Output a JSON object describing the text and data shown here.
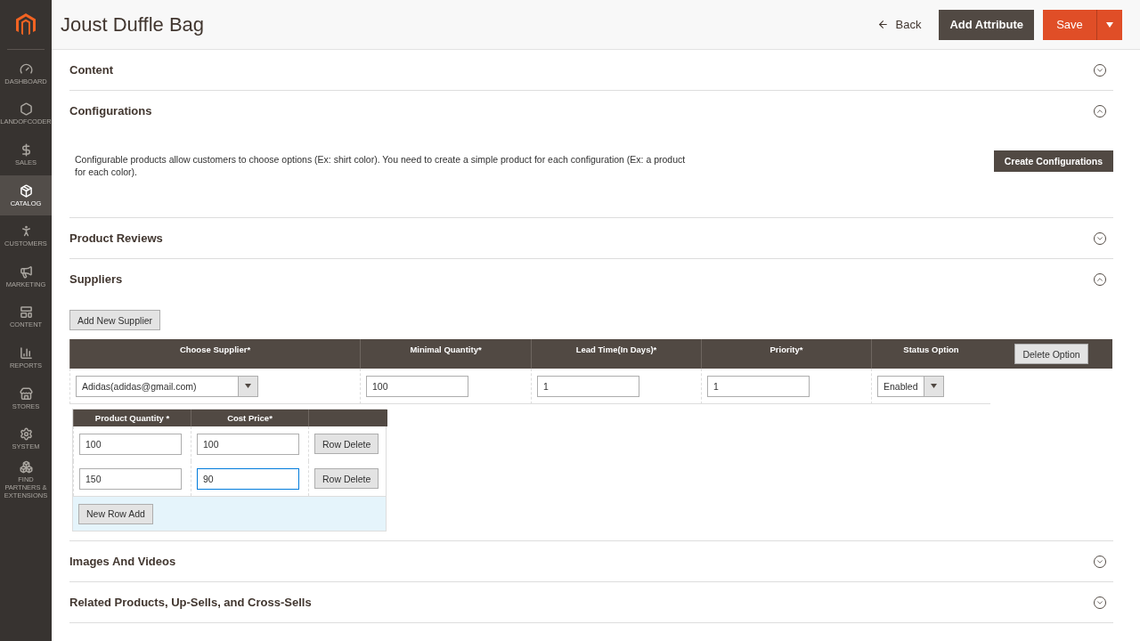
{
  "sidebar": {
    "items": [
      {
        "label": "DASHBOARD",
        "selected": false
      },
      {
        "label": "LANDOFCODER",
        "selected": false
      },
      {
        "label": "SALES",
        "selected": false
      },
      {
        "label": "CATALOG",
        "selected": true
      },
      {
        "label": "CUSTOMERS",
        "selected": false
      },
      {
        "label": "MARKETING",
        "selected": false
      },
      {
        "label": "CONTENT",
        "selected": false
      },
      {
        "label": "REPORTS",
        "selected": false
      },
      {
        "label": "STORES",
        "selected": false
      },
      {
        "label": "SYSTEM",
        "selected": false
      },
      {
        "label": "FIND PARTNERS & EXTENSIONS",
        "selected": false
      }
    ]
  },
  "header": {
    "title": "Joust Duffle Bag",
    "back": "Back",
    "add_attribute": "Add Attribute",
    "save": "Save"
  },
  "sections": [
    {
      "title": "Content",
      "expanded": false
    },
    {
      "kind": "text",
      "title": "Configurations",
      "expanded": true,
      "description": "Configurable products allow customers to choose options (Ex: shirt color). You need to create a simple product for each configuration (Ex: a product for each color).",
      "button": "Create Configurations"
    },
    {
      "title": "Product Reviews",
      "expanded": false
    },
    {
      "kind": "suppliers",
      "title": "Suppliers",
      "expanded": true,
      "add_button": "Add New Supplier",
      "columns": [
        "Choose Supplier*",
        "Minimal Quantity*",
        "Lead Time(In Days)*",
        "Priority*",
        "Status Option"
      ],
      "delete_button": "Delete Option",
      "row": {
        "supplier": "Adidas(adidas@gmail.com)",
        "minimal_quantity": "100",
        "lead_time": "1",
        "priority": "1",
        "status": "Enabled"
      },
      "tiers": {
        "columns": [
          "Product Quantity *",
          "Cost Price*"
        ],
        "rows": [
          {
            "quantity": "100",
            "cost_price": "100",
            "focused": false,
            "delete_button": "Row Delete"
          },
          {
            "quantity": "150",
            "cost_price": "90",
            "focused": true,
            "delete_button": "Row Delete"
          }
        ],
        "add_button": "New Row Add"
      }
    },
    {
      "title": "Images And Videos",
      "expanded": false
    },
    {
      "title": "Related Products, Up-Sells, and Cross-Sells",
      "expanded": false
    }
  ]
}
